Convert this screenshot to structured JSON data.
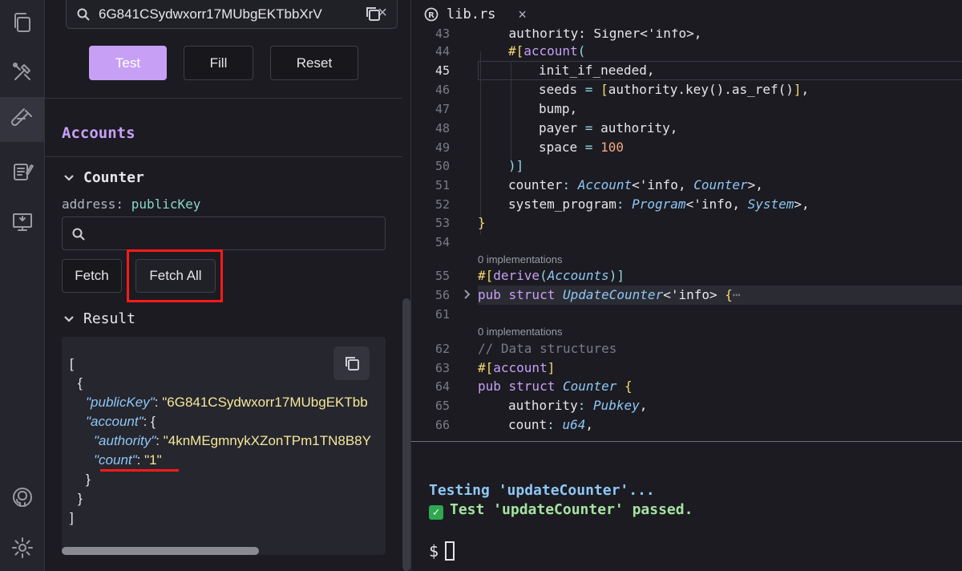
{
  "sidebar_icons": [
    "copy-files-icon",
    "tools-icon",
    "test-tube-icon",
    "notepad-icon",
    "monitor-icon",
    "github-icon",
    "gear-icon"
  ],
  "test_panel": {
    "address_value": "6G841CSydwxorr17MUbgEKTbbXrV",
    "clear_glyph": "×",
    "buttons": {
      "test": "Test",
      "fill": "Fill",
      "reset": "Reset"
    },
    "accounts_title": "Accounts",
    "account_name": "Counter",
    "address_label": "address:",
    "address_type": "publicKey",
    "fetch_label": "Fetch",
    "fetch_all_label": "Fetch All",
    "result_label": "Result",
    "result_json": {
      "open_bracket": "[",
      "open_brace": "{",
      "public_key_key": "\"publicKey\"",
      "public_key_val": "\"6G841CSydwxorr17MUbgEKTbb",
      "account_key": "\"account\"",
      "authority_key": "\"authority\"",
      "authority_val": "\"4knMEgmnykXZonTPm1TN8B8Y",
      "count_key": "\"count\"",
      "count_val": "\"1\"",
      "close_inner": "}",
      "close_brace": "}",
      "close_bracket": "]"
    }
  },
  "editor": {
    "tab_name": "lib.rs",
    "tab_close": "×",
    "current_line": "45",
    "impl_hint_1": "0 implementations",
    "impl_hint_2": "0 implementations",
    "line_numbers": [
      "43",
      "44",
      "45",
      "46",
      "47",
      "48",
      "49",
      "50",
      "51",
      "52",
      "53",
      "54",
      "55",
      "56",
      "61",
      "62",
      "63",
      "64",
      "65",
      "66"
    ],
    "code": {
      "l43": "    authority: Signer<'info>,",
      "l44a": "#[",
      "l44b": "account",
      "l44c": "(",
      "l45": "init_if_needed,",
      "l46a": "seeds",
      "l46b": " = ",
      "l46c": "[",
      "l46d": "authority.key().as_ref()",
      "l46e": "]",
      "l46f": ",",
      "l47": "bump,",
      "l48a": "payer",
      "l48b": " = ",
      "l48c": "authority,",
      "l49a": "space",
      "l49b": " = ",
      "l49c": "100",
      "l50": ")]",
      "l51a": "counter",
      "l51b": ": ",
      "l51c": "Account",
      "l51d": "<'info, ",
      "l51e": "Counter",
      "l51f": ">,",
      "l52a": "system_program",
      "l52b": ": ",
      "l52c": "Program",
      "l52d": "<'info, ",
      "l52e": "System",
      "l52f": ">,",
      "l53": "}",
      "l55a": "#[",
      "l55b": "derive",
      "l55c": "(",
      "l55d": "Accounts",
      "l55e": ")]",
      "l56a": "pub struct ",
      "l56b": "UpdateCounter",
      "l56c": "<'info> ",
      "l56d": "{",
      "l56e": "⋯",
      "l62": "// Data structures",
      "l63a": "#[",
      "l63b": "account",
      "l63c": "]",
      "l64a": "pub struct ",
      "l64b": "Counter",
      "l64c": " {",
      "l65a": "authority",
      "l65b": ": ",
      "l65c": "Pubkey",
      "l65d": ",",
      "l66a": "count",
      "l66b": ": ",
      "l66c": "u64",
      "l66d": ","
    }
  },
  "terminal": {
    "line1": "Testing 'updateCounter'...",
    "check_glyph": "✓",
    "line2": "Test 'updateCounter' passed.",
    "prompt": "$"
  },
  "colors": {
    "accent_purple": "#c7a0f6",
    "highlight_red": "#ff1a1a",
    "string_yellow": "#f5e89a",
    "key_blue": "#8ec7f5",
    "success_green": "#a6e3a1"
  }
}
